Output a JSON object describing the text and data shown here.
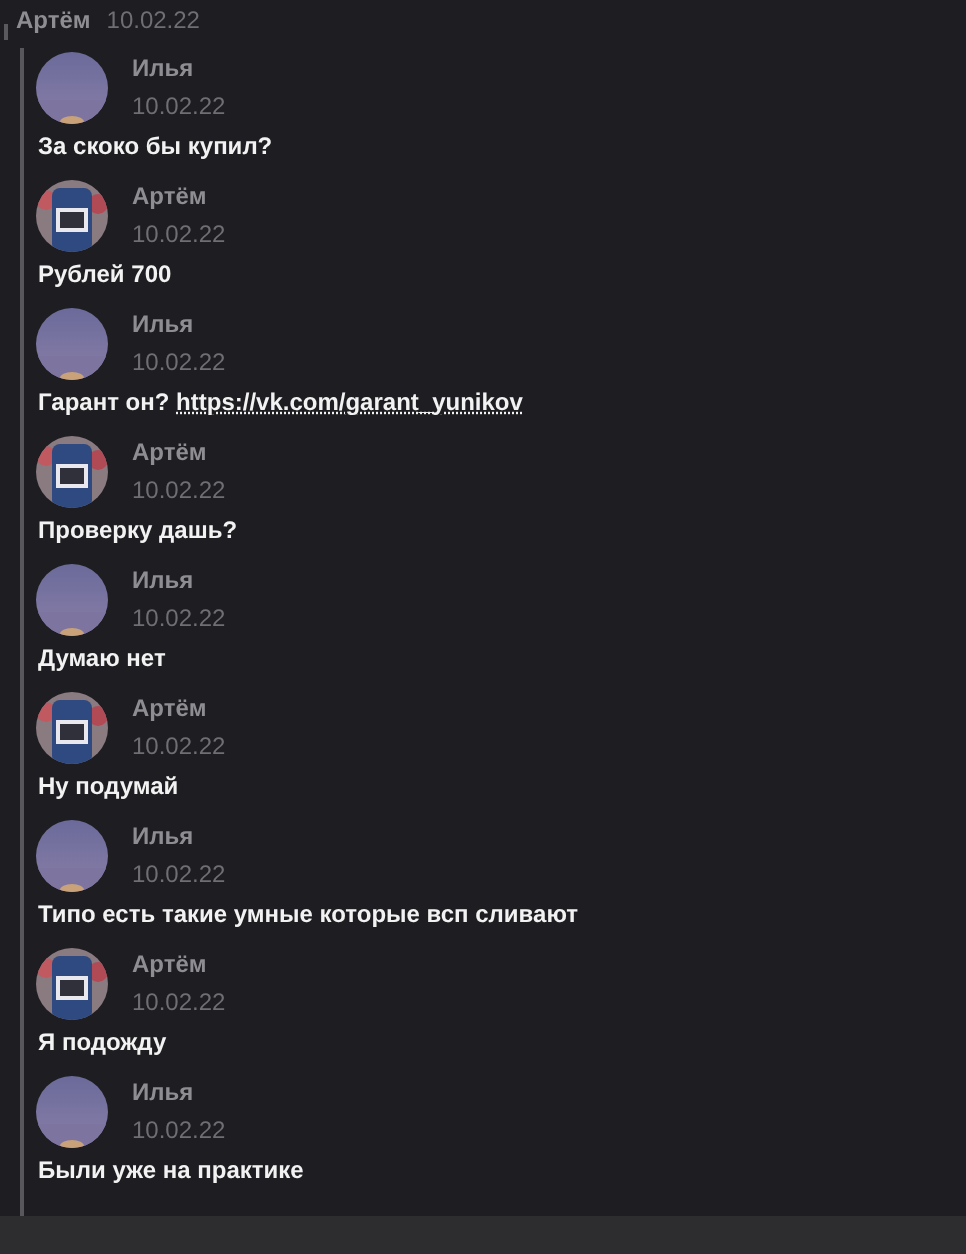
{
  "parent": {
    "author": "Артём",
    "date": "10.02.22"
  },
  "messages": [
    {
      "author": "Илья",
      "date": "10.02.22",
      "kind": "sky",
      "text": "За скоко бы купил?"
    },
    {
      "author": "Артём",
      "date": "10.02.22",
      "kind": "shirt",
      "text": "Рублей 700"
    },
    {
      "author": "Илья",
      "date": "10.02.22",
      "kind": "sky",
      "text": "Гарант он?",
      "link": "https://vk.com/garant_yunikov"
    },
    {
      "author": "Артём",
      "date": "10.02.22",
      "kind": "shirt",
      "text": "Проверку дашь?"
    },
    {
      "author": "Илья",
      "date": "10.02.22",
      "kind": "sky",
      "text": "Думаю нет"
    },
    {
      "author": "Артём",
      "date": "10.02.22",
      "kind": "shirt",
      "text": "Ну подумай"
    },
    {
      "author": "Илья",
      "date": "10.02.22",
      "kind": "sky",
      "text": "Типо есть такие умные которые всп сливают"
    },
    {
      "author": "Артём",
      "date": "10.02.22",
      "kind": "shirt",
      "text": "Я подожду"
    },
    {
      "author": "Илья",
      "date": "10.02.22",
      "kind": "sky",
      "text": "Были уже на практике"
    }
  ]
}
